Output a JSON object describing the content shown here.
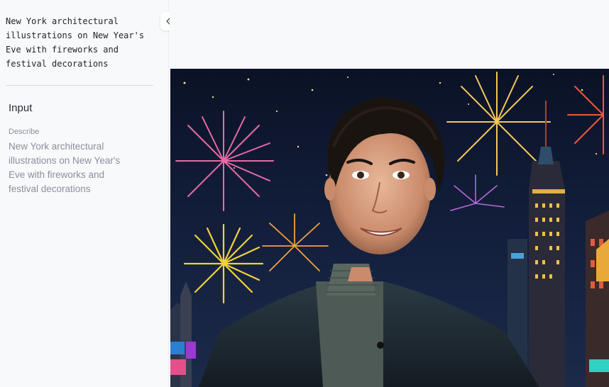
{
  "sidebar": {
    "prompt_text": "New York architectural illustrations on New Year's Eve with fireworks and festival decorations",
    "section_title": "Input",
    "field_label": "Describe",
    "field_value": "New York architectural illustrations on New Year's Eve with fireworks and festival decorations",
    "collapse_icon": "double-chevron-left-icon"
  },
  "main": {
    "image_alt": "generated-portrait-image"
  }
}
